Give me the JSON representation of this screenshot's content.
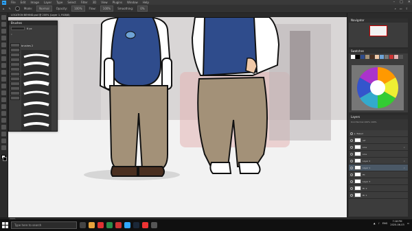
{
  "menubar": {
    "items": [
      "File",
      "Edit",
      "Image",
      "Layer",
      "Type",
      "Select",
      "Filter",
      "3D",
      "View",
      "Plugins",
      "Window",
      "Help"
    ],
    "window_controls": [
      "–",
      "□",
      "✕"
    ]
  },
  "options": {
    "mode_label": "Mode:",
    "mode_value": "Normal",
    "opacity_label": "Opacity:",
    "opacity_value": "100%",
    "flow_label": "Flow:",
    "flow_value": "100%",
    "smoothing_label": "Smoothing:",
    "smoothing_value": "0%"
  },
  "document_tab": "LOCATION BEHIND.psd @ 200% (Layer 1, RGB/8)",
  "brushes_panel": {
    "title": "Brushes",
    "size_value": "6 px",
    "folder_label": "brushes 2"
  },
  "navigator": {
    "title": "Navigator"
  },
  "swatches": {
    "title": "Swatches"
  },
  "layers": {
    "title": "Layers",
    "filter_label": "Kind",
    "blend_mode": "Normal",
    "opacity_value": "100%",
    "fill_value": "100%",
    "rows": [
      {
        "name": "Baked",
        "selected": false
      },
      {
        "name": "ref",
        "selected": false
      },
      {
        "name": "Line",
        "selected": false
      },
      {
        "name": "Line",
        "selected": false
      },
      {
        "name": "Layer 2",
        "selected": false
      },
      {
        "name": "Layer 1",
        "selected": true
      },
      {
        "name": "Fit",
        "selected": false
      },
      {
        "name": "Layer 3",
        "selected": false
      },
      {
        "name": "Bc 2",
        "selected": false
      },
      {
        "name": "Bc 1",
        "selected": false
      }
    ]
  },
  "status": {
    "zoom": "200%"
  },
  "taskbar": {
    "search_placeholder": "Type here to search",
    "language": "ENG",
    "time": "7:18 PM",
    "date": "2020-06-03"
  },
  "colors": {
    "vest": "#2f4c8c",
    "pants": "#a39178",
    "shirt": "#ffffff",
    "selection": "#4a5866",
    "ps_blue": "#31a8ff"
  }
}
